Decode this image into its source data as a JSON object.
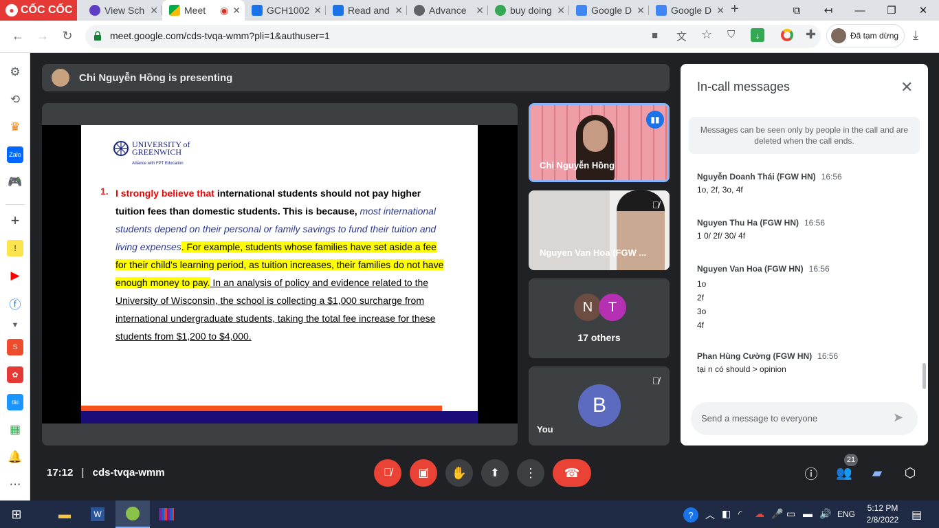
{
  "browser": {
    "brand": "CỐC CỐC",
    "tabs": [
      {
        "title": "View Sch",
        "active": false
      },
      {
        "title": "Meet",
        "active": true
      },
      {
        "title": "GCH1002",
        "active": false
      },
      {
        "title": "Read and",
        "active": false
      },
      {
        "title": "Advance",
        "active": false
      },
      {
        "title": "buy doing",
        "active": false
      },
      {
        "title": "Google D",
        "active": false
      },
      {
        "title": "Google D",
        "active": false
      }
    ],
    "new_tab": "+",
    "url": "meet.google.com/cds-tvqa-wmm?pli=1&authuser=1",
    "profile_status": "Đã tạm dừng"
  },
  "presenting": {
    "banner": "Chi Nguyễn Hồng is presenting"
  },
  "slide": {
    "logo_line1": "UNIVERSITY of",
    "logo_line2": "GREENWICH",
    "logo_line3": "Alliance with FPT Education",
    "number": "1.",
    "lines": [
      {
        "red": "I strongly believe that",
        "bold": " international students should not pay higher"
      },
      {
        "bold": "tuition fees than domestic students. This is because,",
        "blue": " most international"
      },
      {
        "blue": "students depend on their personal or family savings to fund their tuition and"
      },
      {
        "blue": "living expenses",
        "hl": ". For example, students whose families have set aside a fee"
      },
      {
        "hl": "for their child's learning period, as tuition increases, their families do not have"
      },
      {
        "hl": "enough money to pay.",
        "ul": " In an analysis of policy and evidence related to the"
      },
      {
        "ul": "University of Wisconsin, the school is collecting a $1,000 surcharge from"
      },
      {
        "ul": "international undergraduate students, taking the total fee increase for these"
      },
      {
        "ul": "students from $1,200 to $4,000."
      }
    ]
  },
  "participants": {
    "presenter_name": "Chi Nguyễn Hồng",
    "second_name": "Nguyen Van Hoa (FGW ...",
    "others_initials": [
      "N",
      "T"
    ],
    "others_label": "17 others",
    "you_label": "You",
    "you_initial": "B"
  },
  "chat": {
    "title": "In-call messages",
    "notice": "Messages can be seen only by people in the call and are deleted when the call ends.",
    "messages": [
      {
        "sender": "Nguyễn Doanh Thái (FGW HN)",
        "time": "16:56",
        "lines": [
          "1o, 2f, 3o, 4f"
        ]
      },
      {
        "sender": "Nguyen Thu Ha (FGW HN)",
        "time": "16:56",
        "lines": [
          "1 0/ 2f/ 30/ 4f"
        ]
      },
      {
        "sender": "Nguyen Van Hoa (FGW HN)",
        "time": "16:56",
        "lines": [
          "1o",
          "2f",
          "3o",
          "4f"
        ]
      },
      {
        "sender": "Phan Hùng Cường (FGW HN)",
        "time": "16:56",
        "lines": [
          "tại n có should > opinion"
        ]
      }
    ],
    "input_placeholder": "Send a message to everyone"
  },
  "controls": {
    "time": "17:12",
    "divider": "|",
    "meeting_code": "cds-tvqa-wmm",
    "people_count": "21"
  },
  "taskbar": {
    "language": "ENG",
    "clock_time": "5:12 PM",
    "clock_date": "2/8/2022"
  },
  "colors": {
    "meet_bg": "#202124",
    "tile_bg": "#3c4043",
    "end_call": "#ea4335",
    "active_speaker": "#8ab4f8",
    "chat_accent": "#1a73e8",
    "taskbar": "#1f2b44"
  }
}
